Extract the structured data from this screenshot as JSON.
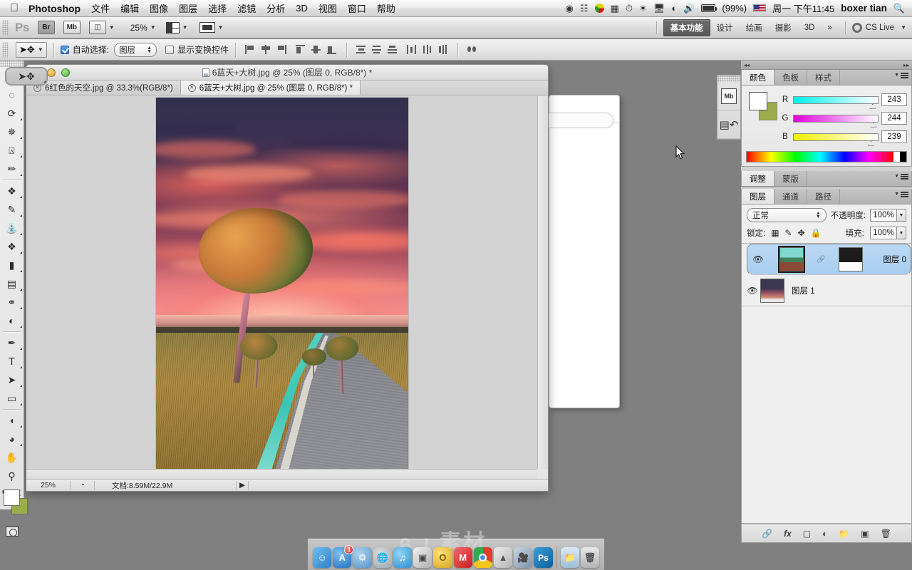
{
  "menubar": {
    "apple": "apple-logo",
    "app_name": "Photoshop",
    "items": [
      "文件",
      "编辑",
      "图像",
      "图层",
      "选择",
      "滤镜",
      "分析",
      "3D",
      "视图",
      "窗口",
      "帮助"
    ],
    "status": {
      "battery_percent": "(99%)",
      "day_time": "周一 下午11:45",
      "user": "boxer tian",
      "icons": [
        "screen-record-icon",
        "caption-icon",
        "color-pie-icon",
        "keyboard-icon",
        "timemachine-icon",
        "bluetooth-icon",
        "display-icon",
        "wifi-icon",
        "volume-icon",
        "battery-icon",
        "flag-icon",
        "search-icon"
      ]
    }
  },
  "appbar": {
    "logo": "Ps",
    "bridge": "Br",
    "mini_bridge": "Mb",
    "view_extras": "view-extras-icon",
    "zoom": "25%",
    "arrange": "arrange-documents-icon",
    "screen_mode": "screen-mode-icon",
    "workspaces": [
      "基本功能",
      "设计",
      "绘画",
      "摄影",
      "3D"
    ],
    "workspace_active": "基本功能",
    "more": "»",
    "cs_live": "CS Live"
  },
  "optionsbar": {
    "tool": "move-tool",
    "auto_select_label": "自动选择:",
    "auto_select_checked": true,
    "auto_select_value": "图层",
    "show_transform_label": "显示变换控件",
    "show_transform_checked": false,
    "align_group": [
      "align-left-edges",
      "align-horizontal-centers",
      "align-right-edges",
      "align-top-edges",
      "align-vertical-centers",
      "align-bottom-edges"
    ],
    "distribute_group": [
      "distribute-top-edges",
      "distribute-vertical-centers",
      "distribute-bottom-edges",
      "distribute-left-edges",
      "distribute-horizontal-centers",
      "distribute-right-edges"
    ],
    "auto_align": "auto-align-layers"
  },
  "toolbar": {
    "tools": [
      {
        "name": "move-tool",
        "glyph": "✥",
        "selected": true
      },
      {
        "name": "marquee-tool",
        "glyph": "◌",
        "selected": false
      },
      {
        "name": "lasso-tool",
        "glyph": "◯",
        "selected": false
      },
      {
        "name": "magic-wand-tool",
        "glyph": "✳",
        "selected": false
      },
      {
        "name": "crop-tool",
        "glyph": "⌗",
        "selected": false
      },
      {
        "name": "eyedropper-tool",
        "glyph": "✎",
        "selected": false
      },
      {
        "name": "healing-brush-tool",
        "glyph": "❥",
        "selected": false
      },
      {
        "name": "brush-tool",
        "glyph": "✒",
        "selected": false
      },
      {
        "name": "clone-stamp-tool",
        "glyph": "⎙",
        "selected": false
      },
      {
        "name": "history-brush-tool",
        "glyph": "✂",
        "selected": false
      },
      {
        "name": "eraser-tool",
        "glyph": "▰",
        "selected": false
      },
      {
        "name": "gradient-tool",
        "glyph": "▤",
        "selected": false
      },
      {
        "name": "blur-tool",
        "glyph": "💧",
        "selected": false
      },
      {
        "name": "dodge-tool",
        "glyph": "◕",
        "selected": false
      },
      {
        "name": "pen-tool",
        "glyph": "✐",
        "selected": false
      },
      {
        "name": "type-tool",
        "glyph": "T",
        "selected": false
      },
      {
        "name": "path-selection-tool",
        "glyph": "➤",
        "selected": false
      },
      {
        "name": "rectangle-shape-tool",
        "glyph": "▭",
        "selected": false
      },
      {
        "name": "rotate-3d-object-tool",
        "glyph": "◍",
        "selected": false
      },
      {
        "name": "rotate-3d-camera-tool",
        "glyph": "◑",
        "selected": false
      },
      {
        "name": "hand-tool",
        "glyph": "✋",
        "selected": false
      },
      {
        "name": "zoom-tool",
        "glyph": "🔍",
        "selected": false
      }
    ],
    "foreground_color": "#ffffff",
    "background_color": "#9aad4a",
    "quick_mask": "quick-mask-mode"
  },
  "document": {
    "title": "6蓝天+大树.jpg @ 25% (图层 0, RGB/8*) *",
    "tabs": [
      {
        "label": "6红色的天空.jpg @ 33.3%(RGB/8*)",
        "active": false
      },
      {
        "label": "6蓝天+大树.jpg @ 25% (图层 0, RGB/8*) *",
        "active": true
      }
    ],
    "status": {
      "zoom": "25%",
      "doc_info": "文档:8.59M/22.9M"
    }
  },
  "panels": {
    "color": {
      "tabs": [
        "颜色",
        "色板",
        "样式"
      ],
      "active_tab": "颜色",
      "channels": [
        {
          "label": "R",
          "value": "243"
        },
        {
          "label": "G",
          "value": "244"
        },
        {
          "label": "B",
          "value": "239"
        }
      ]
    },
    "adjustments": {
      "tabs": [
        "调整",
        "蒙版"
      ],
      "active_tab": "调整"
    },
    "layers": {
      "tabs": [
        "图层",
        "通道",
        "路径"
      ],
      "active_tab": "图层",
      "blend_mode": "正常",
      "opacity_label": "不透明度:",
      "opacity_value": "100%",
      "lock_label": "锁定:",
      "lock_icons": [
        "lock-transparent-pixels",
        "lock-image-pixels",
        "lock-position",
        "lock-all"
      ],
      "fill_label": "填充:",
      "fill_value": "100%",
      "items": [
        {
          "name": "图层 0",
          "selected": true,
          "visible": true,
          "has_mask": true
        },
        {
          "name": "图层 1",
          "selected": false,
          "visible": true,
          "has_mask": false
        }
      ],
      "footer_icons": [
        "link-layers-icon",
        "layer-style-fx-icon",
        "add-mask-icon",
        "adjustment-layer-icon",
        "new-group-icon",
        "new-layer-icon",
        "delete-layer-icon"
      ]
    },
    "minidock": [
      "mini-bridge-icon",
      "history-icon"
    ]
  },
  "dock": {
    "items": [
      {
        "name": "finder",
        "label": "",
        "color": "#4a9de0"
      },
      {
        "name": "app-store",
        "label": "A",
        "color": "#2f7fd8",
        "badge": "1"
      },
      {
        "name": "system-preferences",
        "label": "",
        "color": "#6fa8d8"
      },
      {
        "name": "browser-globe",
        "label": "",
        "color": "#9aa8b4"
      },
      {
        "name": "itunes",
        "label": "♪",
        "color": "#4aa8dc"
      },
      {
        "name": "image-viewer",
        "label": "",
        "color": "#bdbdbd"
      },
      {
        "name": "opera",
        "label": "O",
        "color": "#e8c23c"
      },
      {
        "name": "m-app",
        "label": "M",
        "color": "#e23a3a"
      },
      {
        "name": "chrome",
        "label": "",
        "color": "#4caf50"
      },
      {
        "name": "photo-app",
        "label": "",
        "color": "#c8c8c8"
      },
      {
        "name": "imovie",
        "label": "",
        "color": "#8fa6bd"
      },
      {
        "name": "photoshop",
        "label": "Ps",
        "color": "#1b7bb8"
      },
      {
        "name": "downloads-folder",
        "label": "",
        "color": "#aec8de"
      },
      {
        "name": "trash",
        "label": "",
        "color": "#c6c6c6"
      }
    ]
  },
  "watermark": "ɕ ɹ 素材"
}
